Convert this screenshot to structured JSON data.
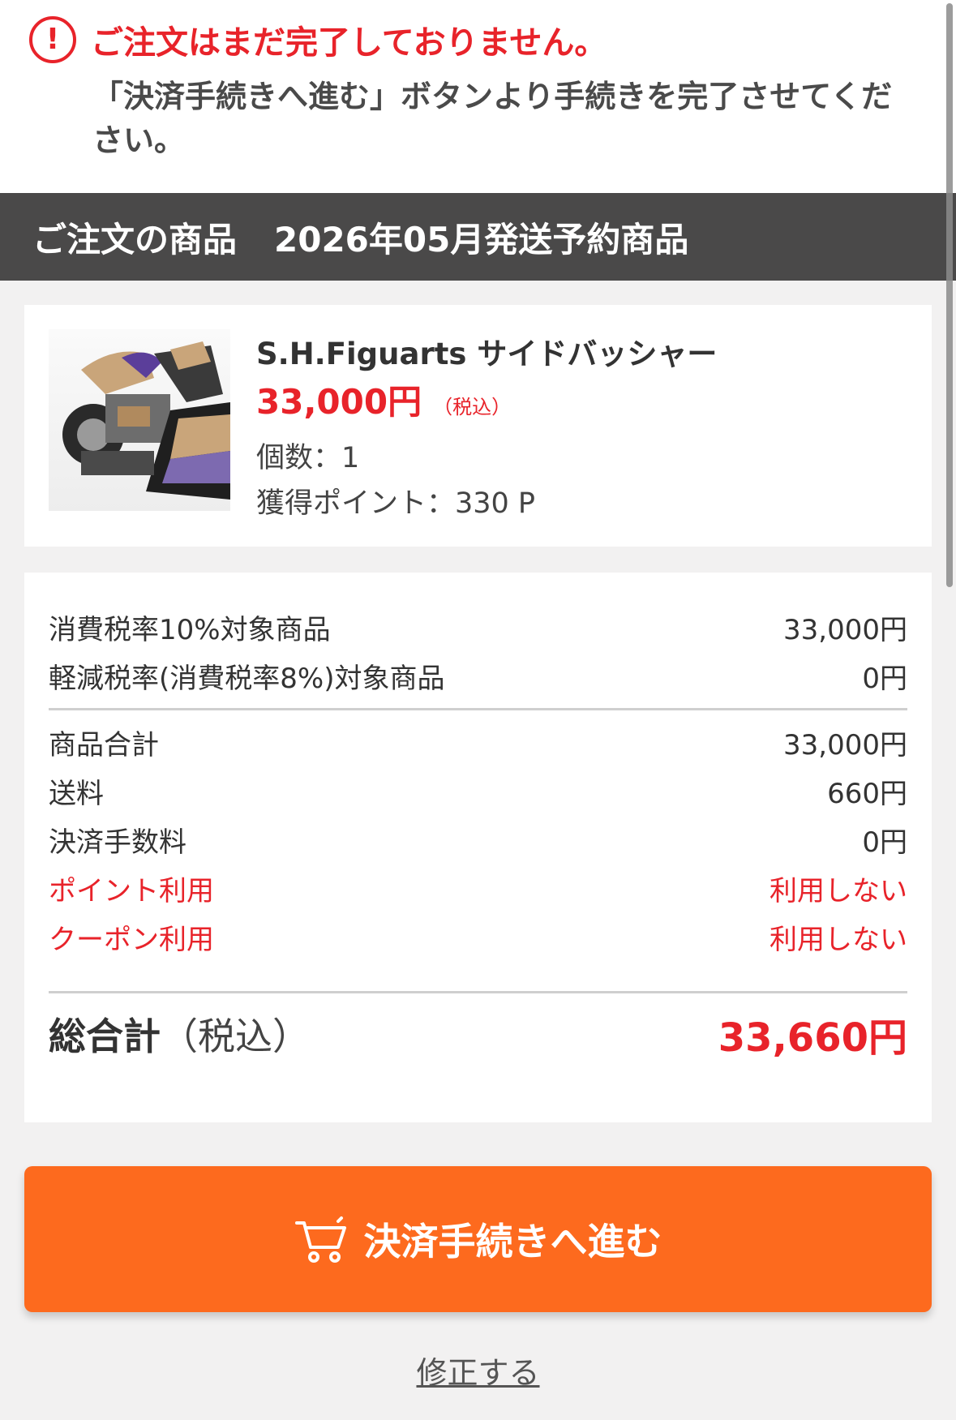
{
  "notice": {
    "title": "ご注文はまだ完了しておりません。",
    "message": "「決済手続きへ進む」ボタンより手続きを完了させてください。",
    "icon": "alert-circle-icon",
    "icon_glyph": "!",
    "color": "#e8232a"
  },
  "section": {
    "title": "ご注文の商品",
    "subtitle": "2026年05月発送予約商品"
  },
  "product": {
    "name": "S.H.Figuarts サイドバッシャー",
    "price": "33,000円",
    "tax_note": "（税込）",
    "quantity": "個数：1",
    "points": "獲得ポイント：330 P",
    "image_label": "product-image"
  },
  "summary": {
    "tax_rows": [
      {
        "label": "消費税率10%対象商品",
        "value": "33,000円"
      },
      {
        "label": "軽減税率(消費税率8%)対象商品",
        "value": "0円"
      }
    ],
    "cost_rows": [
      {
        "label": "商品合計",
        "value": "33,000円"
      },
      {
        "label": "送料",
        "value": "660円"
      },
      {
        "label": "決済手数料",
        "value": "0円"
      }
    ],
    "discount_rows": [
      {
        "label": "ポイント利用",
        "value": "利用しない"
      },
      {
        "label": "クーポン利用",
        "value": "利用しない"
      }
    ],
    "total": {
      "label": "総合計",
      "sub": "（税込）",
      "value": "33,660円"
    }
  },
  "actions": {
    "checkout_label": "決済手続きへ進む",
    "checkout_icon": "cart-icon",
    "edit_label": "修正する"
  },
  "colors": {
    "accent": "#fd6a1e",
    "alert": "#e8232a",
    "header_bg": "#4a4949",
    "page_bg": "#f2f1f1"
  }
}
